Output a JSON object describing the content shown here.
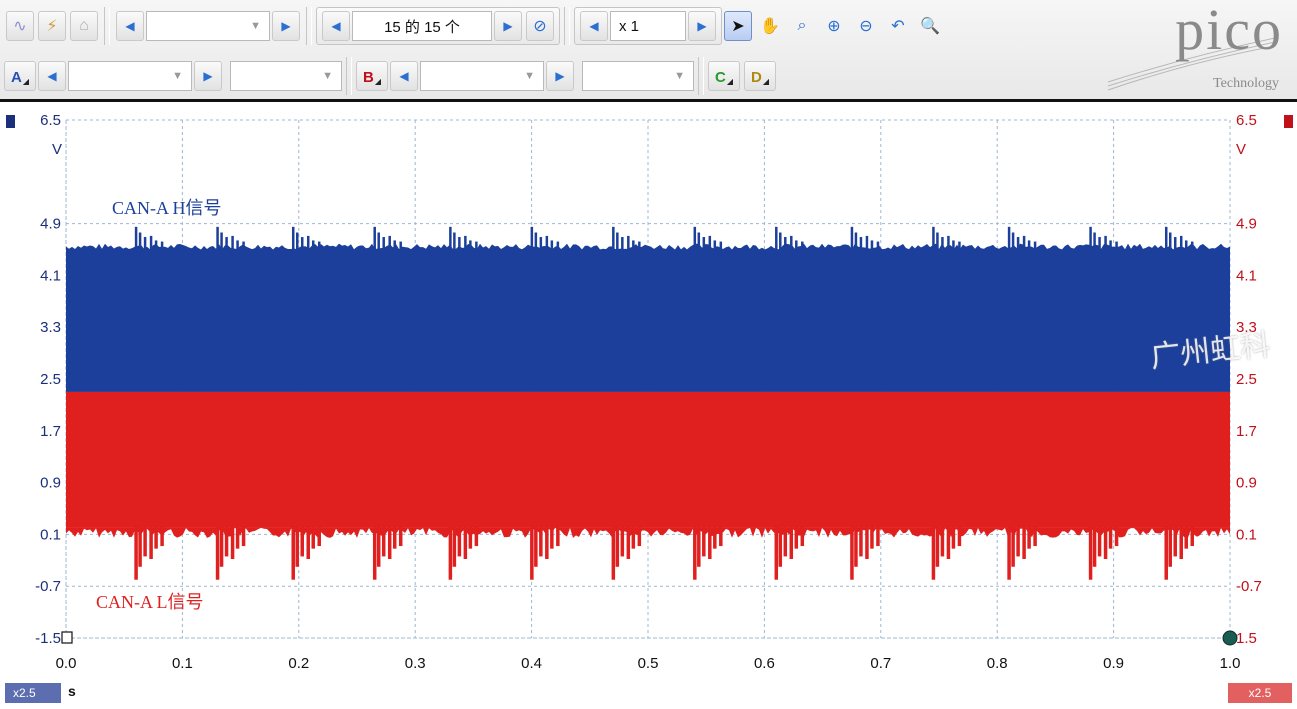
{
  "toolbar": {
    "row1": {
      "view_counter": "15 的 15 个",
      "zoom_value": "x 1"
    },
    "row2": {
      "channel_a": "A",
      "channel_b": "B",
      "channel_c": "C",
      "channel_d": "D"
    },
    "brand_word": "pico",
    "brand_sub": "Technology"
  },
  "chart": {
    "unit_left_top": "6.5",
    "unit_left_unit": "V",
    "unit_right_top": "6.5",
    "unit_right_unit": "V",
    "x_unit": "s",
    "zoom_left": "x2.5",
    "zoom_right": "x2.5",
    "watermark": "广州虹科",
    "colors": {
      "high": "#1b3f9a",
      "low": "#e01f1f",
      "grid": "#9fb7d2",
      "axis_text": "#1b2f7a",
      "right_text": "#c0101a"
    }
  },
  "chart_data": {
    "type": "area",
    "x_ticks": [
      "0.0",
      "0.1",
      "0.2",
      "0.3",
      "0.4",
      "0.5",
      "0.6",
      "0.7",
      "0.8",
      "0.9",
      "1.0"
    ],
    "y_ticks_left": [
      "6.5",
      "4.9",
      "4.1",
      "3.3",
      "2.5",
      "1.7",
      "0.9",
      "0.1",
      "-0.7",
      "-1.5"
    ],
    "y_ticks_right": [
      "6.5",
      "4.9",
      "4.1",
      "3.3",
      "2.5",
      "1.7",
      "0.9",
      "0.1",
      "-0.7",
      "1.5"
    ],
    "xlim": [
      0.0,
      1.0
    ],
    "ylim": [
      -1.5,
      6.5
    ],
    "series": [
      {
        "name": "CAN-A H信号",
        "color": "#1b3f9a",
        "band": [
          2.3,
          4.5
        ],
        "spike_peak": 4.85
      },
      {
        "name": "CAN-A L信号",
        "color": "#e01f1f",
        "band": [
          0.2,
          2.3
        ],
        "spike_low": -0.6
      }
    ],
    "burst_x": [
      0.06,
      0.13,
      0.195,
      0.265,
      0.33,
      0.4,
      0.47,
      0.54,
      0.61,
      0.675,
      0.745,
      0.81,
      0.88,
      0.945
    ]
  }
}
